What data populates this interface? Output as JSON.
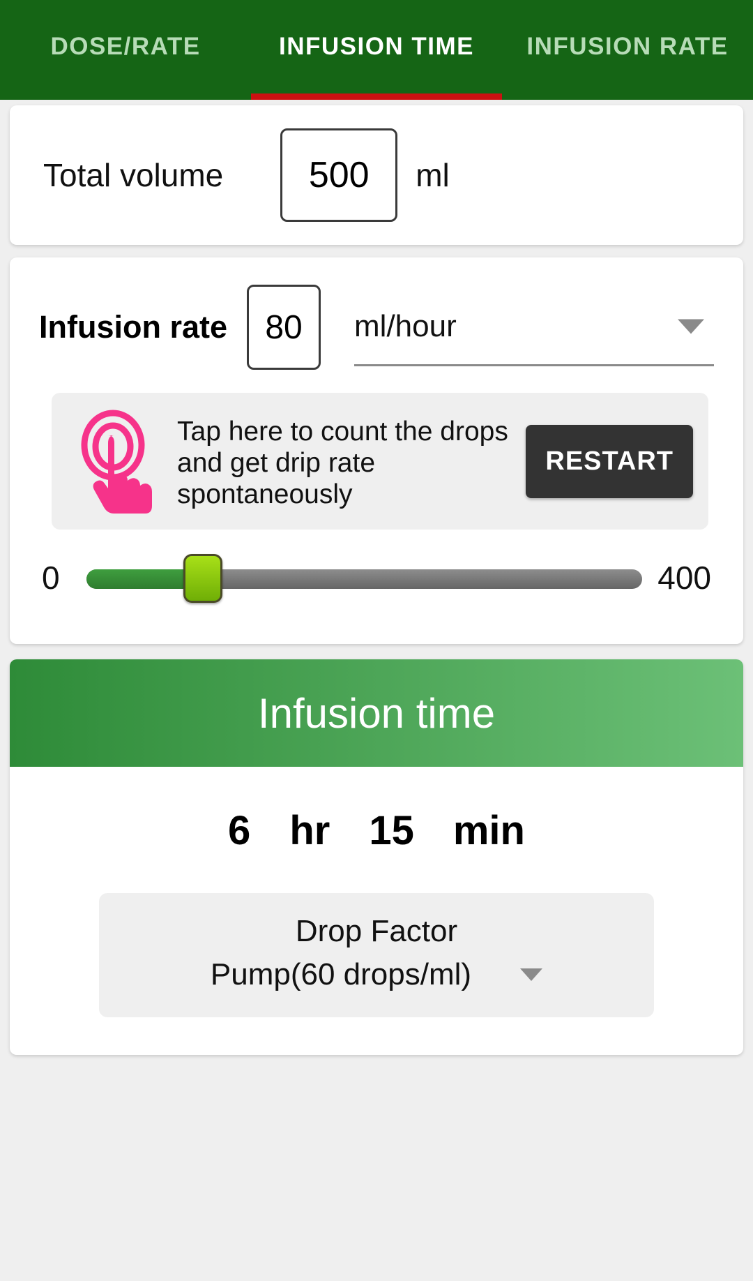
{
  "tabs": [
    {
      "label": "DOSE/RATE",
      "active": false
    },
    {
      "label": "INFUSION TIME",
      "active": true
    },
    {
      "label": "INFUSION RATE",
      "active": false
    }
  ],
  "total_volume": {
    "label": "Total volume",
    "value": "500",
    "unit": "ml"
  },
  "infusion_rate": {
    "label": "Infusion rate",
    "value": "80",
    "unit_selected": "ml/hour",
    "caret_icon": "chevron-down-icon"
  },
  "tap_panel": {
    "icon": "tap-hand-icon",
    "text": "Tap here to count the drops and get drip rate spontaneously",
    "restart_label": "RESTART"
  },
  "slider": {
    "min_label": "0",
    "max_label": "400",
    "min": 0,
    "max": 400,
    "value": 80
  },
  "result": {
    "header": "Infusion time",
    "hours_value": "6",
    "hours_unit": "hr",
    "minutes_value": "15",
    "minutes_unit": "min"
  },
  "drop_factor": {
    "label": "Drop Factor",
    "value": "Pump(60 drops/ml)",
    "caret_icon": "chevron-down-icon"
  },
  "colors": {
    "tabbar_green": "#156515",
    "tab_indicator_red": "#cc1111",
    "header_gradient_start": "#2e8b38",
    "header_gradient_end": "#6cc077",
    "tap_icon_pink": "#f6338a",
    "restart_dark": "#333333",
    "slider_fill_green": "#3f9e3f",
    "slider_thumb_green": "#8fcc10"
  }
}
